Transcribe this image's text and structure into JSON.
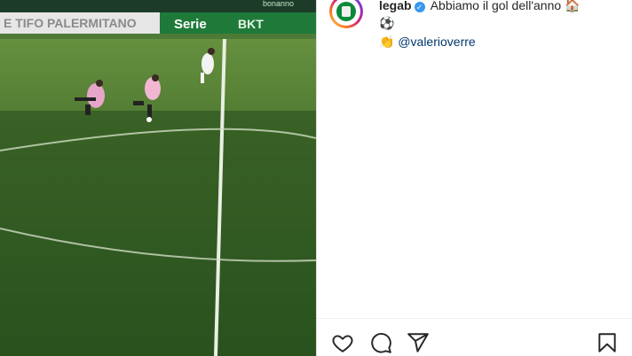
{
  "media": {
    "banner_left": "E TIFO PALERMITANO",
    "banner_serie": "Serie",
    "banner_sponsor": "BKT",
    "banner_top": "bonanno"
  },
  "post": {
    "username": "legab",
    "verified_icon": "verified-badge-icon",
    "caption_text": "Abbiamo il gol dell'anno",
    "caption_emoji_1": "🏠",
    "line2_emoji": "⚽",
    "line3_emoji": "👏",
    "mention": "@valerioverre"
  },
  "actions": {
    "like": "heart-icon",
    "comment": "comment-icon",
    "share": "share-icon",
    "save": "bookmark-icon"
  },
  "colors": {
    "pitch": "#3f6a2a",
    "mention": "#00376b",
    "verified": "#3897f0"
  }
}
